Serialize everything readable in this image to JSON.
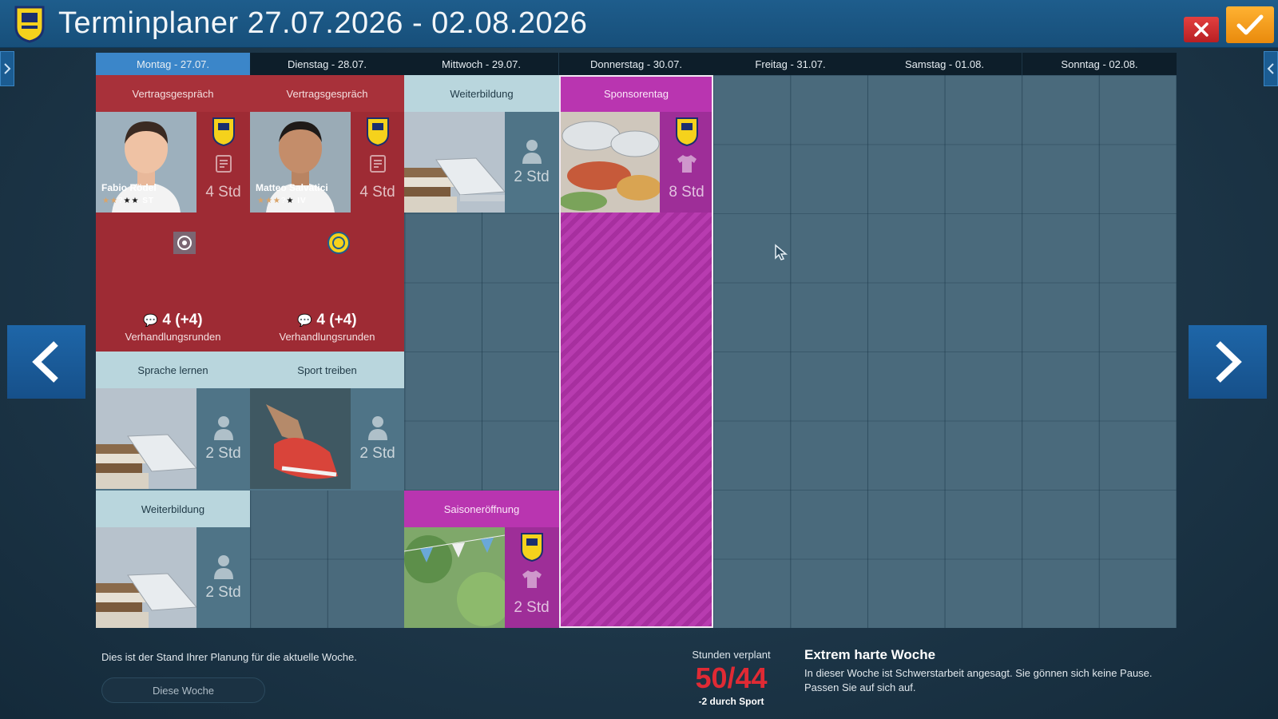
{
  "header": {
    "title": "Terminplaner 27.07.2026 - 02.08.2026",
    "club_logo_icon": "club-crest-icon",
    "close_icon": "close-x-icon",
    "confirm_icon": "checkmark-icon"
  },
  "days": [
    {
      "label": "Montag - 27.07.",
      "active": true
    },
    {
      "label": "Dienstag - 28.07.",
      "active": false
    },
    {
      "label": "Mittwoch - 29.07.",
      "active": false
    },
    {
      "label": "Donnerstag - 30.07.",
      "active": false
    },
    {
      "label": "Freitag - 31.07.",
      "active": false
    },
    {
      "label": "Samstag - 01.08.",
      "active": false
    },
    {
      "label": "Sonntag - 02.08.",
      "active": false
    }
  ],
  "appointments": {
    "mon_contract": {
      "title": "Vertragsgespräch",
      "player": "Fabio Rödel",
      "position": "ST",
      "hours": "4 Std",
      "rounds": "4 (+4)",
      "rounds_label": "Verhandlungsrunden"
    },
    "tue_contract": {
      "title": "Vertragsgespräch",
      "player": "Matteo Salvatici",
      "position": "IV",
      "hours": "4 Std",
      "rounds": "4 (+4)",
      "rounds_label": "Verhandlungsrunden"
    },
    "wed_training": {
      "title": "Weiterbildung",
      "hours": "2 Std"
    },
    "thu_sponsor": {
      "title": "Sponsorentag",
      "hours": "8 Std"
    },
    "mon_language": {
      "title": "Sprache lernen",
      "hours": "2 Std"
    },
    "tue_sport": {
      "title": "Sport treiben",
      "hours": "2 Std"
    },
    "mon_training": {
      "title": "Weiterbildung",
      "hours": "2 Std"
    },
    "wed_season": {
      "title": "Saisoneröffnung",
      "hours": "2 Std"
    }
  },
  "footer": {
    "status_text": "Dies ist der Stand Ihrer Planung für die aktuelle Woche.",
    "week_button": "Diese Woche",
    "hours_label": "Stunden verplant",
    "hours_value": "50/44",
    "hours_sub": "-2 durch Sport",
    "warning_title": "Extrem harte Woche",
    "warning_text": "In dieser Woche ist Schwerstarbeit angesagt. Sie gönnen sich keine Pause. Passen Sie auf sich auf."
  },
  "colors": {
    "contract": "#a8313a",
    "sponsor": "#b935b0",
    "light_head": "#b9d6dd",
    "active_day": "#3b86c9",
    "overload": "#e02a34"
  }
}
